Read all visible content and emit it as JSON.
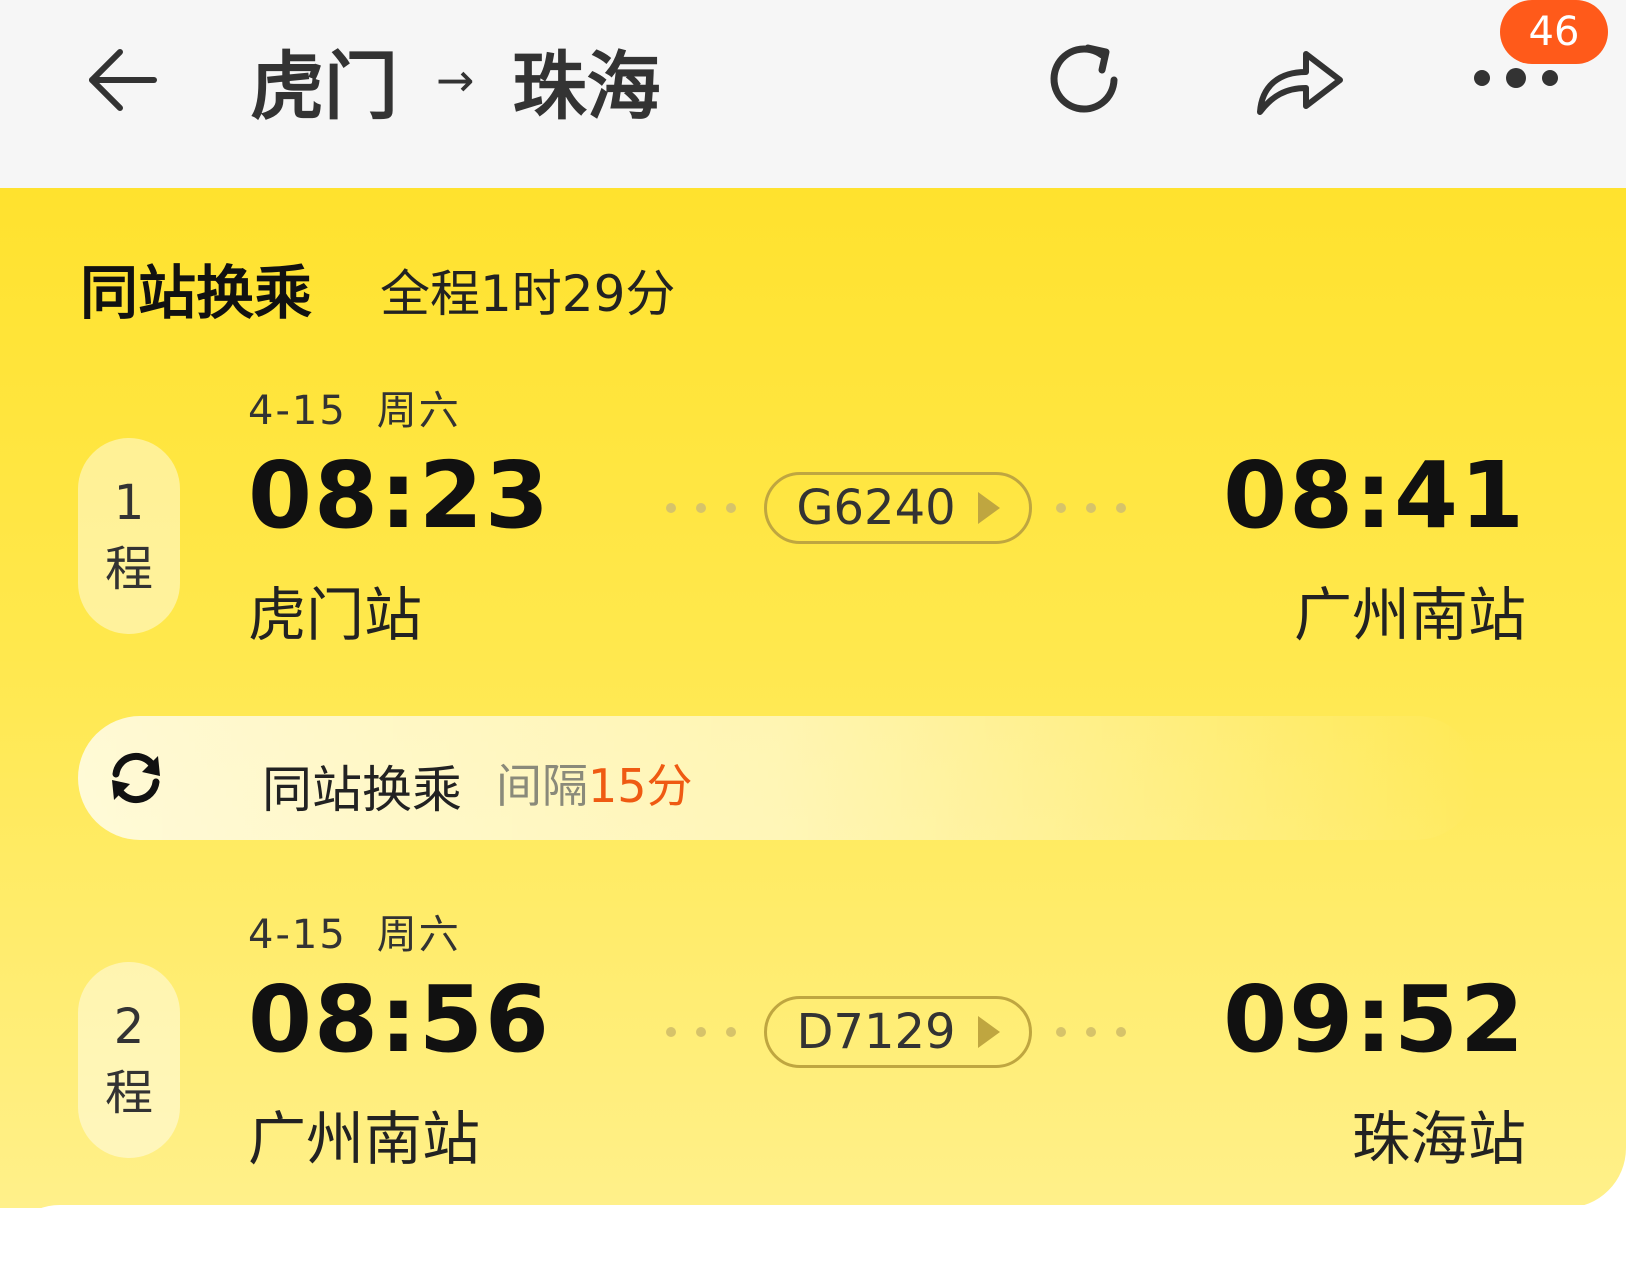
{
  "header": {
    "origin": "虎门",
    "arrow": "→",
    "destination": "珠海",
    "notification_count": "46",
    "icons": [
      "back-arrow-icon",
      "refresh-icon",
      "share-icon",
      "more-icon"
    ]
  },
  "card": {
    "title": "同站换乘",
    "subtitle": "全程1时29分"
  },
  "legs": [
    {
      "index": "1",
      "index_suffix": "程",
      "date": "4-15",
      "weekday": "周六",
      "depart_time": "08:23",
      "depart_station": "虎门站",
      "train_no": "G6240",
      "arrive_time": "08:41",
      "arrive_station": "广州南站"
    },
    {
      "index": "2",
      "index_suffix": "程",
      "date": "4-15",
      "weekday": "周六",
      "depart_time": "08:56",
      "depart_station": "广州南站",
      "train_no": "D7129",
      "arrive_time": "09:52",
      "arrive_station": "珠海站"
    }
  ],
  "transfer": {
    "label": "同站换乘",
    "gap_prefix": "间隔",
    "gap_value": "15分"
  },
  "colors": {
    "card_yellow": "#ffe22e",
    "accent_orange": "#ef5a12",
    "badge_orange": "#ff5a1a"
  }
}
